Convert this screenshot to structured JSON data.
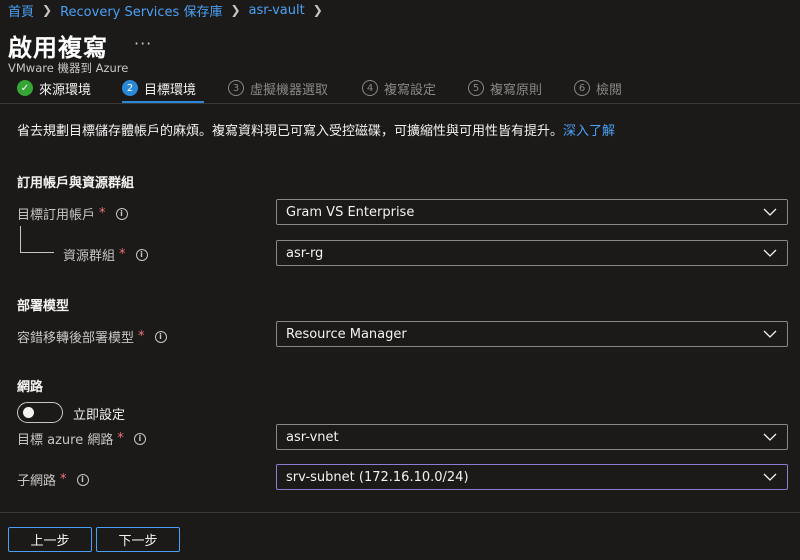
{
  "breadcrumb": {
    "items": [
      "首頁",
      "Recovery Services 保存庫",
      "asr-vault"
    ]
  },
  "page": {
    "title": "啟用複寫",
    "more": "···",
    "subtitle": "VMware 機器到 Azure"
  },
  "steps": [
    {
      "num": "✓",
      "label": "來源環境",
      "state": "done"
    },
    {
      "num": "2",
      "label": "目標環境",
      "state": "active"
    },
    {
      "num": "3",
      "label": "虛擬機器選取",
      "state": "pending"
    },
    {
      "num": "4",
      "label": "複寫設定",
      "state": "pending"
    },
    {
      "num": "5",
      "label": "複寫原則",
      "state": "pending"
    },
    {
      "num": "6",
      "label": "檢閱",
      "state": "pending"
    }
  ],
  "description": {
    "text": "省去規劃目標儲存體帳戶的麻煩。複寫資料現已可寫入受控磁碟，可擴縮性與可用性皆有提升。",
    "link": "深入了解"
  },
  "sections": {
    "subscription": {
      "title": "訂用帳戶與資源群組",
      "target_subscription_label": "目標訂用帳戶",
      "target_subscription_value": "Gram VS Enterprise",
      "resource_group_label": "資源群組",
      "resource_group_value": "asr-rg"
    },
    "deployment": {
      "title": "部署模型",
      "model_label": "容錯移轉後部署模型",
      "model_value": "Resource Manager"
    },
    "network": {
      "title": "網路",
      "toggle_label": "立即設定",
      "toggle_on": false,
      "vnet_label": "目標 azure 網路",
      "vnet_value": "asr-vnet",
      "subnet_label": "子網路",
      "subnet_value": "srv-subnet (172.16.10.0/24)"
    }
  },
  "footer": {
    "prev_label": "上一步",
    "next_label": "下一步"
  },
  "required_mark": "*",
  "info_glyph": "i",
  "colors": {
    "background": "#1b1a19",
    "link": "#4aa0f5",
    "required": "#f1707b",
    "active_step": "#2b88d8",
    "done_step": "#35a535",
    "focused_border": "#8f7bd1"
  }
}
